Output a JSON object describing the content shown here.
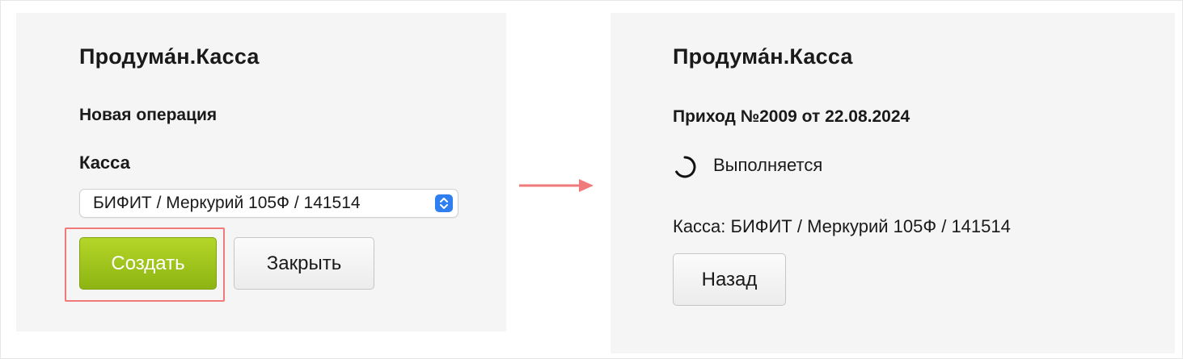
{
  "left_panel": {
    "brand": "Продума́н.Касса",
    "title": "Новая операция",
    "register_label": "Касса",
    "register_select_value": "БИФИТ / Меркурий 105Ф / 141514",
    "create_button": "Создать",
    "close_button": "Закрыть",
    "create_button_color": "#9cc41a",
    "highlight_color": "#f07a7a"
  },
  "right_panel": {
    "brand": "Продума́н.Касса",
    "title": "Приход №2009 от 22.08.2024",
    "status": "Выполняется",
    "register_info": "Касса: БИФИТ / Меркурий 105Ф / 141514",
    "back_button": "Назад"
  },
  "arrow_color": "#f07a7a",
  "icons": {
    "select_caret": "chevron-up-down-icon",
    "status": "spinner-icon",
    "transition": "arrow-right-icon"
  }
}
